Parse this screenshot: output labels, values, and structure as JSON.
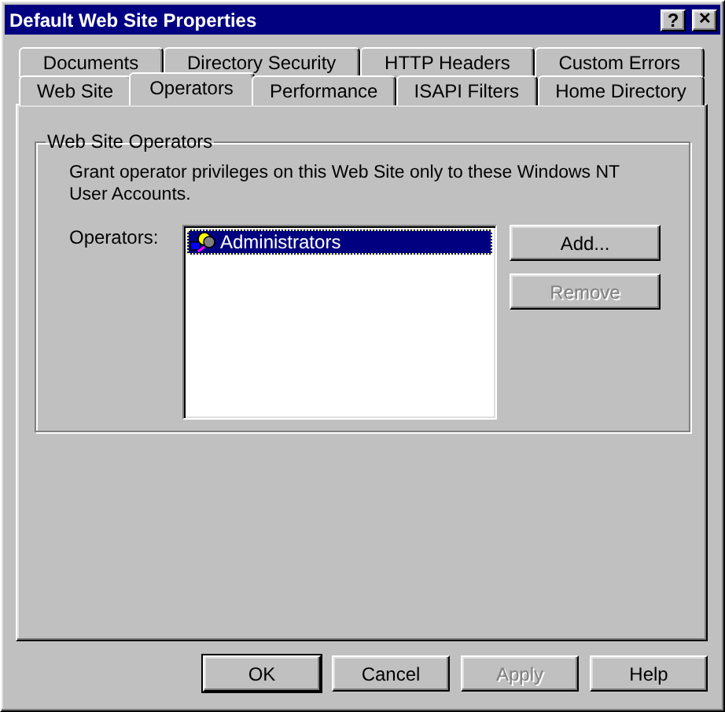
{
  "window": {
    "title": "Default Web Site Properties",
    "controls": [
      {
        "kind": "help",
        "label": "?"
      },
      {
        "kind": "close",
        "label": "✕"
      }
    ]
  },
  "tab_rows": [
    [
      {
        "label": "Documents",
        "selected": false
      },
      {
        "label": "Directory Security",
        "selected": false
      },
      {
        "label": "HTTP Headers",
        "selected": false
      },
      {
        "label": "Custom Errors",
        "selected": false
      }
    ],
    [
      {
        "label": "Web Site",
        "selected": false
      },
      {
        "label": "Operators",
        "selected": true
      },
      {
        "label": "Performance",
        "selected": false
      },
      {
        "label": "ISAPI Filters",
        "selected": false
      },
      {
        "label": "Home Directory",
        "selected": false
      }
    ]
  ],
  "group": {
    "title": "Web Site Operators",
    "description": "Grant operator privileges on this Web Site only to these Windows NT User Accounts.",
    "list_label": "Operators:",
    "operators": [
      {
        "name": "Administrators",
        "selected": true
      }
    ],
    "buttons": [
      {
        "label": "Add...",
        "disabled": false
      },
      {
        "label": "Remove",
        "disabled": true
      }
    ]
  },
  "footer_buttons": [
    {
      "label": "OK",
      "disabled": false,
      "default": true
    },
    {
      "label": "Cancel",
      "disabled": false,
      "default": false
    },
    {
      "label": "Apply",
      "disabled": true,
      "default": false
    },
    {
      "label": "Help",
      "disabled": false,
      "default": false
    }
  ]
}
